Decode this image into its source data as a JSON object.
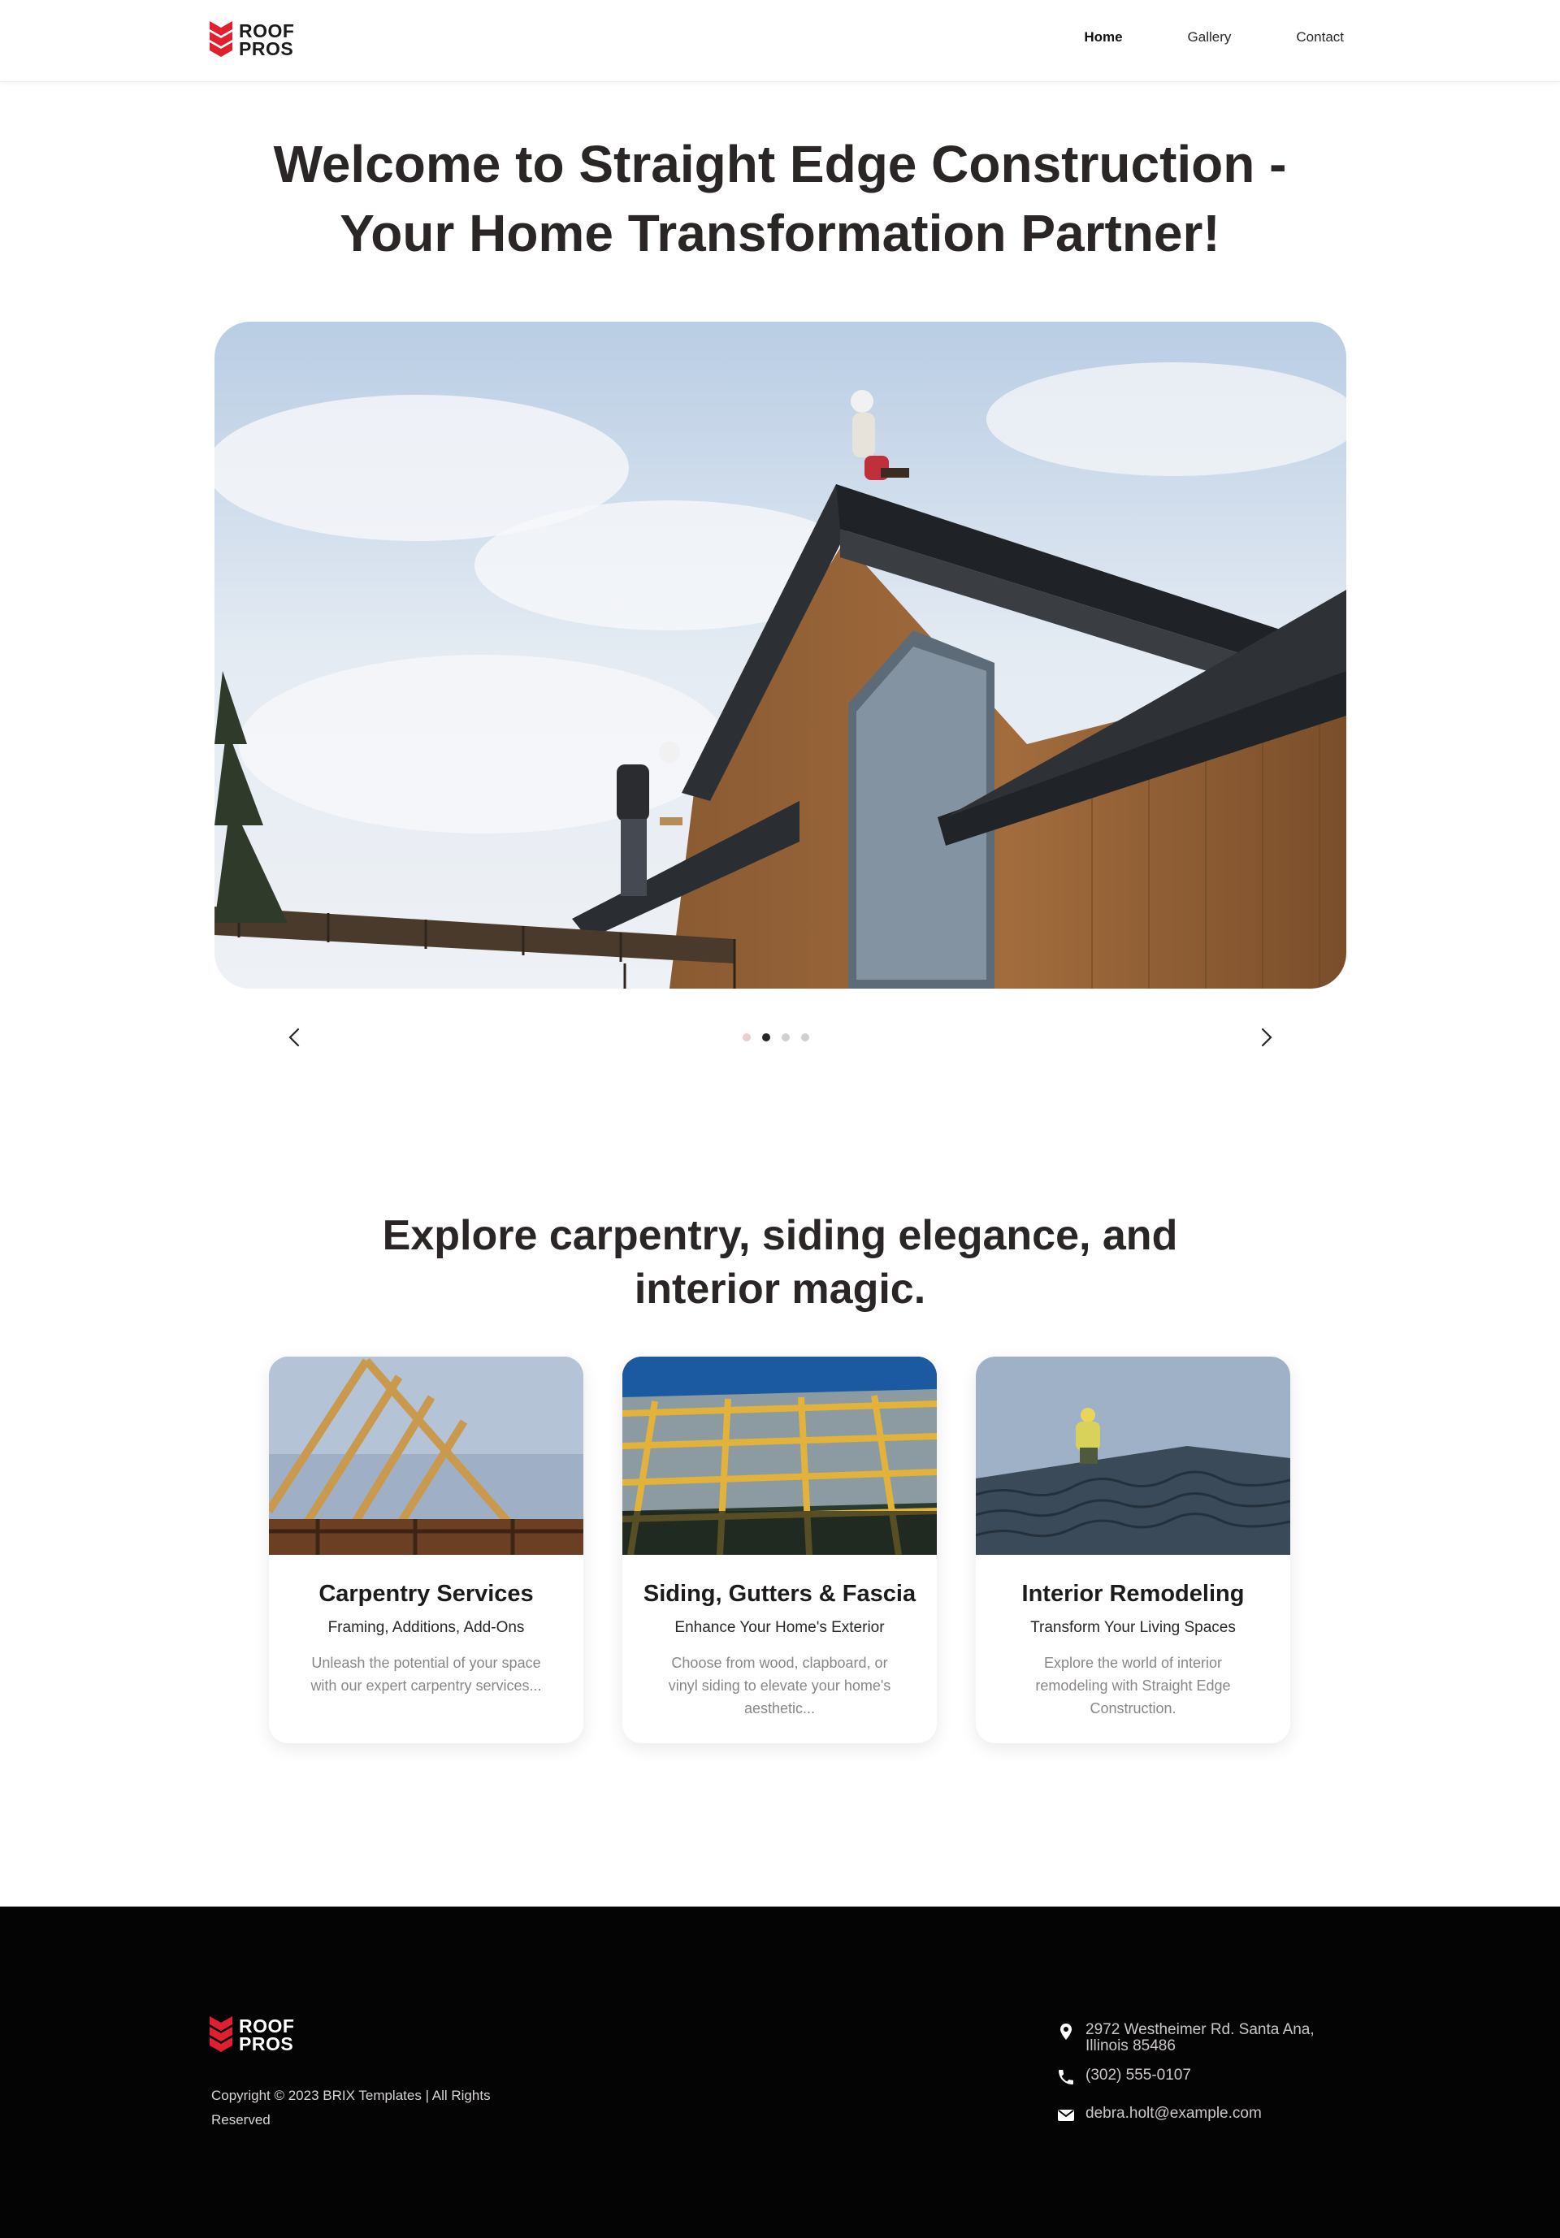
{
  "brand": {
    "line1": "ROOF",
    "line2": "PROS",
    "accent_color": "#e0202e"
  },
  "nav": {
    "items": [
      {
        "label": "Home",
        "active": true
      },
      {
        "label": "Gallery",
        "active": false
      },
      {
        "label": "Contact",
        "active": false
      }
    ]
  },
  "hero": {
    "title": "Welcome to Straight Edge Construction - Your Home Transformation Partner!",
    "slider": {
      "slide_count": 4,
      "active_index": 1,
      "prev_icon": "chevron-left-icon",
      "next_icon": "chevron-right-icon"
    }
  },
  "services": {
    "title": "Explore carpentry, siding elegance, and interior magic.",
    "cards": [
      {
        "title": "Carpentry Services",
        "subtitle": "Framing, Additions, Add-Ons",
        "description": "Unleash the potential of your space with our expert carpentry services..."
      },
      {
        "title": "Siding, Gutters & Fascia",
        "subtitle": "Enhance Your Home's Exterior",
        "description": "Choose from wood, clapboard, or vinyl siding to elevate your home's aesthetic..."
      },
      {
        "title": "Interior Remodeling",
        "subtitle": "Transform Your Living Spaces",
        "description": "Explore the world of interior remodeling with Straight Edge Construction."
      }
    ]
  },
  "footer": {
    "copyright": "Copyright © 2023 BRIX Templates | All Rights Reserved",
    "address": "2972 Westheimer Rd. Santa Ana, Illinois 85486",
    "phone": "(302) 555-0107",
    "email": "debra.holt@example.com",
    "address_icon": "map-pin-icon",
    "phone_icon": "phone-icon",
    "email_icon": "mail-icon"
  }
}
